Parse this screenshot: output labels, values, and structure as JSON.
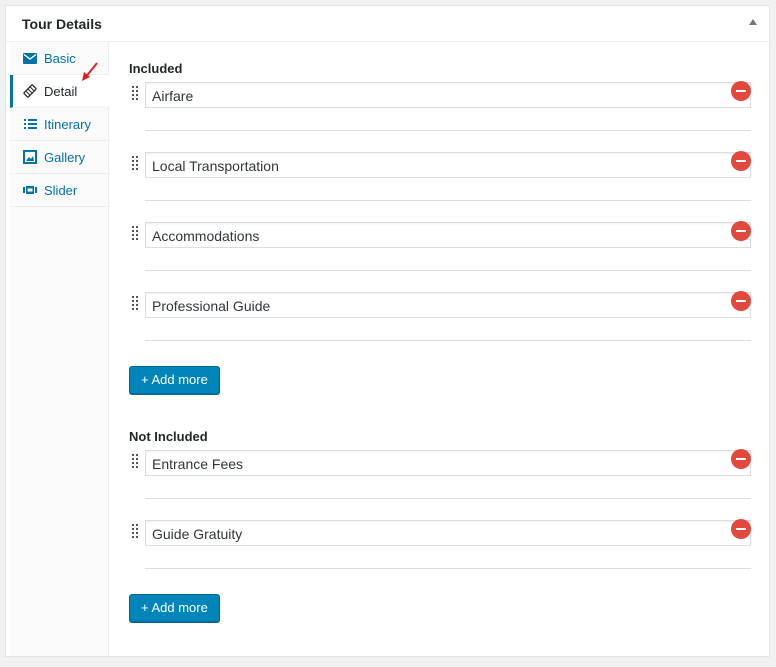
{
  "metabox": {
    "title": "Tour Details"
  },
  "tabs": [
    {
      "label": "Basic",
      "icon": "envelope-icon",
      "active": false
    },
    {
      "label": "Detail",
      "icon": "tag-icon",
      "active": true
    },
    {
      "label": "Itinerary",
      "icon": "list-icon",
      "active": false
    },
    {
      "label": "Gallery",
      "icon": "gallery-icon",
      "active": false
    },
    {
      "label": "Slider",
      "icon": "slider-icon",
      "active": false
    }
  ],
  "included": {
    "title": "Included",
    "items": [
      "Airfare",
      "Local Transportation",
      "Accommodations",
      "Professional Guide"
    ],
    "add_label": "+ Add more"
  },
  "not_included": {
    "title": "Not Included",
    "items": [
      "Entrance Fees",
      "Guide Gratuity"
    ],
    "add_label": "+ Add more"
  },
  "colors": {
    "accent": "#0073aa",
    "button": "#0085ba",
    "remove": "#e2483c",
    "arrow": "#e02020"
  }
}
